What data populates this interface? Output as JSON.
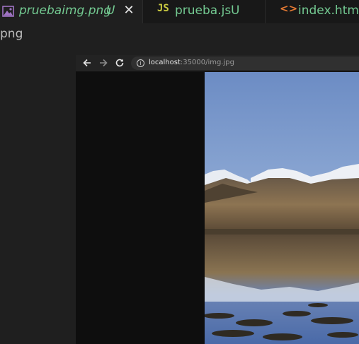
{
  "tabs": [
    {
      "label": "pruebaimg.png",
      "status": "U",
      "icon": "image-icon",
      "close": "✕"
    },
    {
      "label": "prueba.js",
      "status": "U",
      "icon": "js-icon",
      "icon_text": "JS"
    },
    {
      "label": "index.html",
      "icon": "html-icon",
      "icon_text": "<>"
    }
  ],
  "breadcrumb": "png",
  "browser": {
    "url_host": "localhost",
    "url_path": ":35000/img.jpg"
  },
  "colors": {
    "untracked": "#73c991",
    "js": "#cbcb41",
    "html": "#e37933"
  }
}
